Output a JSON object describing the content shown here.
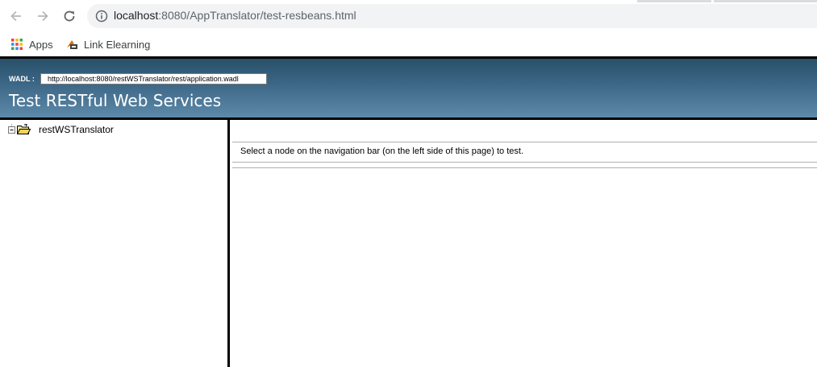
{
  "browser": {
    "url_host": "localhost",
    "url_rest": ":8080/AppTranslator/test-resbeans.html",
    "bookmarks": [
      {
        "label": "Apps",
        "icon": "apps-grid-icon"
      },
      {
        "label": "Link Elearning",
        "icon": "bookmark-site-icon"
      }
    ]
  },
  "banner": {
    "wadl_label": "WADL :",
    "wadl_url": "http://localhost:8080/restWSTranslator/rest/application.wadl",
    "title": "Test RESTful Web Services"
  },
  "tree": {
    "root_label": "restWSTranslator"
  },
  "content": {
    "message": "Select a node on the navigation bar (on the left side of this page) to test."
  },
  "colors": {
    "banner_top": "#28506a",
    "banner_bottom": "#5e8aa9"
  }
}
